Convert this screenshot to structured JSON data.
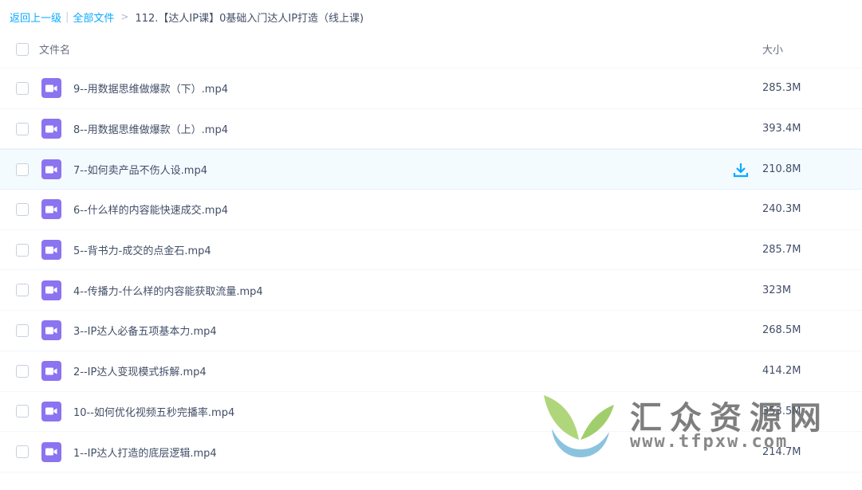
{
  "breadcrumb": {
    "back": "返回上一级",
    "separator": "|",
    "all_files": "全部文件",
    "arrow": ">",
    "current": "112.【达人IP课】0基础入门达人IP打造（线上课)"
  },
  "header": {
    "name_col": "文件名",
    "size_col": "大小"
  },
  "files": [
    {
      "name": "9--用数据思维做爆款（下）.mp4",
      "size": "285.3M"
    },
    {
      "name": "8--用数据思维做爆款（上）.mp4",
      "size": "393.4M"
    },
    {
      "name": "7--如何卖产品不伤人设.mp4",
      "size": "210.8M"
    },
    {
      "name": "6--什么样的内容能快速成交.mp4",
      "size": "240.3M"
    },
    {
      "name": "5--背书力-成交的点金石.mp4",
      "size": "285.7M"
    },
    {
      "name": "4--传播力-什么样的内容能获取流量.mp4",
      "size": "323M"
    },
    {
      "name": "3--IP达人必备五项基本力.mp4",
      "size": "268.5M"
    },
    {
      "name": "2--IP达人变现模式拆解.mp4",
      "size": "414.2M"
    },
    {
      "name": "10--如何优化视频五秒完播率.mp4",
      "size": "353.5M"
    },
    {
      "name": "1--IP达人打造的底层逻辑.mp4",
      "size": "214.7M"
    }
  ],
  "hovered_row_index": 2,
  "icons": {
    "file_icon": "video-file-icon",
    "row_action": "download-icon"
  },
  "colors": {
    "link": "#09aaff",
    "video_icon": "#8c73f0",
    "hover_row": "#f4fbff",
    "download": "#09aaff"
  },
  "watermark": {
    "title": "汇众资源网",
    "url": "www.tfpxw.com"
  }
}
